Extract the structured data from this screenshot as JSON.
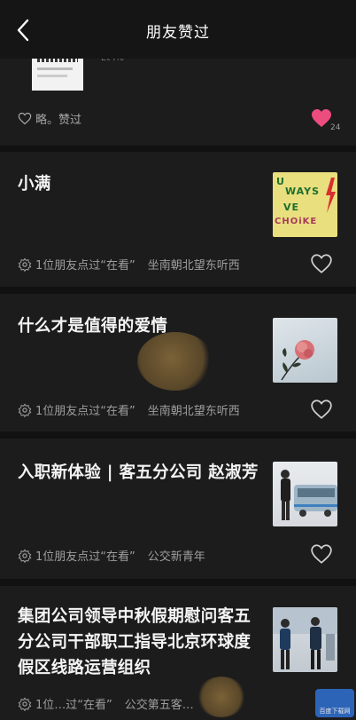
{
  "header": {
    "title": "朋友赞过"
  },
  "card0": {
    "meta": "略。赞过",
    "like_count": "24",
    "faint_text": "Et I%"
  },
  "cards": [
    {
      "title": "小满",
      "likes_text": "1位朋友点过“在看”",
      "source": "坐南朝北望东听西"
    },
    {
      "title": "什么才是值得的爱情",
      "likes_text": "1位朋友点过“在看”",
      "source": "坐南朝北望东听西"
    },
    {
      "title": "入职新体验 | 客五分公司 赵淑芳",
      "likes_text": "1位朋友点过“在看”",
      "source": "公交新青年"
    },
    {
      "title": "集团公司领导中秋假期慰问客五分公司干部职工指导北京环球度假区线路运营组织",
      "likes_text": "1位…过“在看”",
      "source": "公交第五客…"
    }
  ],
  "thumbs": {
    "ways": [
      "U",
      "WAYS",
      "VE",
      "CHOiKE"
    ]
  },
  "watermark": {
    "badge": "百度下载网"
  },
  "colors": {
    "like_active": "#ec4d7e",
    "card_bg": "#1c1c1c",
    "page_bg": "#111111"
  }
}
